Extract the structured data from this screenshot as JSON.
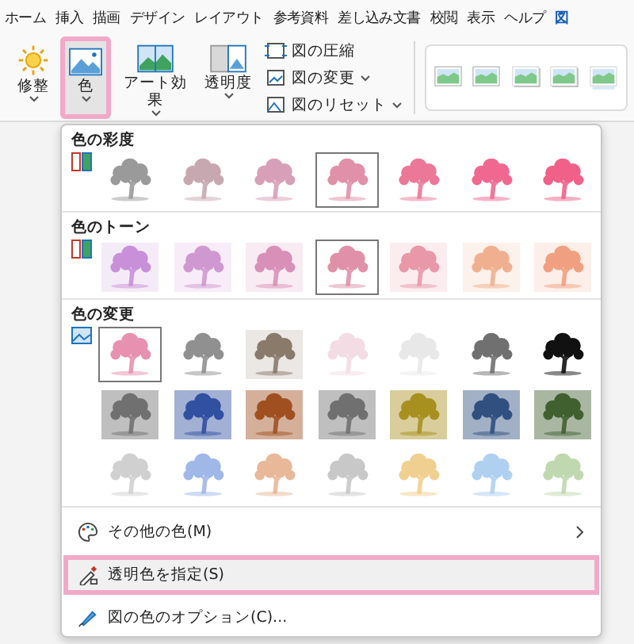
{
  "tabs": [
    {
      "label": "ホーム",
      "selected": false
    },
    {
      "label": "挿入",
      "selected": false
    },
    {
      "label": "描画",
      "selected": false
    },
    {
      "label": "デザイン",
      "selected": false
    },
    {
      "label": "レイアウト",
      "selected": false
    },
    {
      "label": "参考資料",
      "selected": false
    },
    {
      "label": "差し込み文書",
      "selected": false
    },
    {
      "label": "校閲",
      "selected": false
    },
    {
      "label": "表示",
      "selected": false
    },
    {
      "label": "ヘルプ",
      "selected": false
    },
    {
      "label": "図",
      "selected": true
    }
  ],
  "ribbon": {
    "large_buttons": [
      {
        "kind": "sun",
        "label": "修整",
        "selected": false,
        "highlighted": false
      },
      {
        "kind": "picture",
        "label": "色",
        "selected": true,
        "highlighted": true
      },
      {
        "kind": "effects",
        "label": "アート効果",
        "selected": false,
        "highlighted": false
      },
      {
        "kind": "transparency",
        "label": "透明度",
        "selected": false,
        "highlighted": false
      }
    ],
    "small_buttons": [
      {
        "kind": "compress",
        "label": "図の圧縮",
        "dropdown": false
      },
      {
        "kind": "change",
        "label": "図の変更",
        "dropdown": true
      },
      {
        "kind": "reset",
        "label": "図のリセット",
        "dropdown": true
      }
    ],
    "styles": [
      {
        "kind": "frame"
      },
      {
        "kind": "frame"
      },
      {
        "kind": "shadow"
      },
      {
        "kind": "soft"
      },
      {
        "kind": "reflect"
      }
    ]
  },
  "dropdown": {
    "sections": [
      {
        "title": "色の彩度",
        "swatches": [
          {
            "kind": "plain",
            "color": "#9a9a9a",
            "selected": false
          },
          {
            "kind": "plain",
            "color": "#c8a8b0",
            "selected": false
          },
          {
            "kind": "plain",
            "color": "#d8a0b8",
            "selected": false
          },
          {
            "kind": "plain",
            "color": "#e090a8",
            "selected": true
          },
          {
            "kind": "plain",
            "color": "#ec7898",
            "selected": false
          },
          {
            "kind": "plain",
            "color": "#f06890",
            "selected": false
          },
          {
            "kind": "plain",
            "color": "#f06088",
            "selected": false
          }
        ]
      },
      {
        "title": "色のトーン",
        "swatches": [
          {
            "kind": "tinted",
            "color": "#c890d8",
            "selected": false
          },
          {
            "kind": "tinted",
            "color": "#d098d0",
            "selected": false
          },
          {
            "kind": "tinted",
            "color": "#d890b8",
            "selected": false
          },
          {
            "kind": "plain",
            "color": "#e090a8",
            "selected": true
          },
          {
            "kind": "tinted",
            "color": "#e898a8",
            "selected": false
          },
          {
            "kind": "tinted",
            "color": "#f0b090",
            "selected": false
          },
          {
            "kind": "tinted",
            "color": "#f0a080",
            "selected": false
          }
        ]
      },
      {
        "title": "色の変更",
        "swatches": [
          {
            "kind": "plain",
            "color": "#e890b0",
            "selected": true
          },
          {
            "kind": "plain",
            "color": "#909090",
            "selected": false
          },
          {
            "kind": "tinted",
            "color": "#8a7a6a",
            "selected": false
          },
          {
            "kind": "plain",
            "color": "#f4dce4",
            "selected": false
          },
          {
            "kind": "plain",
            "color": "#e8e8e8",
            "selected": false
          },
          {
            "kind": "plain",
            "color": "#707070",
            "selected": false
          },
          {
            "kind": "plain",
            "color": "#111111",
            "selected": false
          },
          {
            "kind": "strong",
            "color": "#707070",
            "selected": false
          },
          {
            "kind": "strong",
            "color": "#3050a0",
            "selected": false
          },
          {
            "kind": "strong",
            "color": "#a05020",
            "selected": false
          },
          {
            "kind": "strong",
            "color": "#707070",
            "selected": false
          },
          {
            "kind": "strong",
            "color": "#a89020",
            "selected": false
          },
          {
            "kind": "strong",
            "color": "#305080",
            "selected": false
          },
          {
            "kind": "strong",
            "color": "#406030",
            "selected": false
          },
          {
            "kind": "plain",
            "color": "#d0d0d0",
            "selected": false
          },
          {
            "kind": "plain",
            "color": "#a0b8e8",
            "selected": false
          },
          {
            "kind": "plain",
            "color": "#e8b898",
            "selected": false
          },
          {
            "kind": "plain",
            "color": "#c8c8c8",
            "selected": false
          },
          {
            "kind": "plain",
            "color": "#f0d090",
            "selected": false
          },
          {
            "kind": "plain",
            "color": "#b0d0f0",
            "selected": false
          },
          {
            "kind": "plain",
            "color": "#c0d8b0",
            "selected": false
          }
        ]
      }
    ],
    "menu_items": [
      {
        "kind": "palette",
        "label": "その他の色(M)",
        "submenu": true,
        "highlighted": false
      },
      {
        "kind": "eyedropper",
        "label": "透明色を指定(S)",
        "submenu": false,
        "highlighted": true
      },
      {
        "kind": "brush",
        "label": "図の色のオプション(C)...",
        "submenu": false,
        "highlighted": false
      }
    ]
  }
}
